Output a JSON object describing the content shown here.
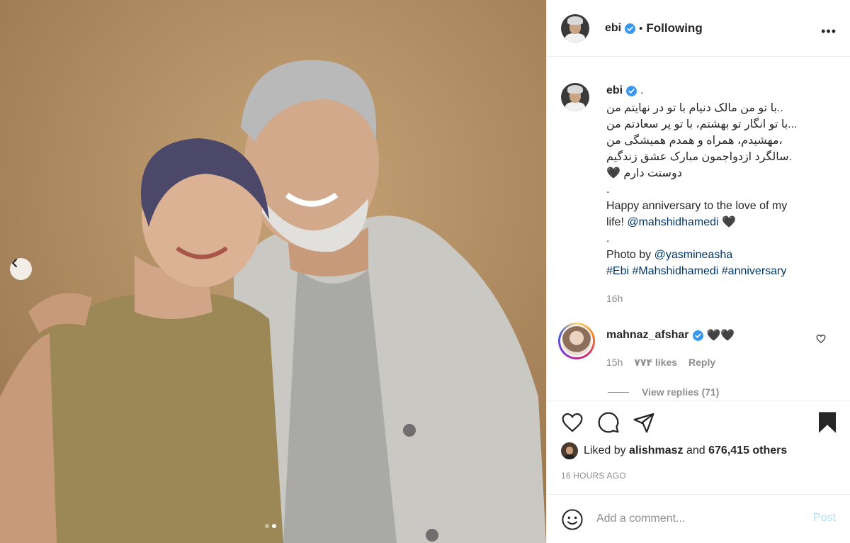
{
  "header": {
    "username": "ebi",
    "separator": "•",
    "follow_status": "Following",
    "more_icon": "•••"
  },
  "caption": {
    "username": "ebi",
    "suffix": ".",
    "lines": [
      "..با تو من مالک دنیام با تو در نهایتم من",
      "...با تو انگار تو بهشتم، با تو پر سعادتم من",
      "،مهشیدم، همراه و همدم همیشگی من",
      ".سالگرد ازدواجمون مبارک عشق زندگیم",
      "دوستت دارم 🖤",
      "."
    ],
    "english_line_1": "Happy anniversary to the love of my",
    "english_line_2_prefix": "life! ",
    "english_mention": "@mahshidhamedi",
    "english_line_2_suffix": " 🖤",
    "dot2": ".",
    "photo_by_prefix": "Photo by ",
    "photo_by_mention": "@yasmineasha",
    "hashtags": "#Ebi #Mahshidhamedi #anniversary",
    "time": "16h"
  },
  "comment": {
    "username": "mahnaz_afshar",
    "text": "🖤🖤",
    "time": "15h",
    "likes": "۷۷۴ likes",
    "reply": "Reply",
    "view_replies": "View replies (71)"
  },
  "likes": {
    "prefix": "Liked by ",
    "user": "alishmasz",
    "middle": " and ",
    "count": "676,415 others"
  },
  "timestamp": "16 HOURS AGO",
  "add_comment": {
    "placeholder": "Add a comment...",
    "post_label": "Post"
  },
  "colors": {
    "verified": "#3897f0",
    "link": "#00376b",
    "muted": "#8e8e8e",
    "post_disabled": "#b2dffc"
  },
  "carousel": {
    "slide_count": 2,
    "active_slide": 2
  }
}
